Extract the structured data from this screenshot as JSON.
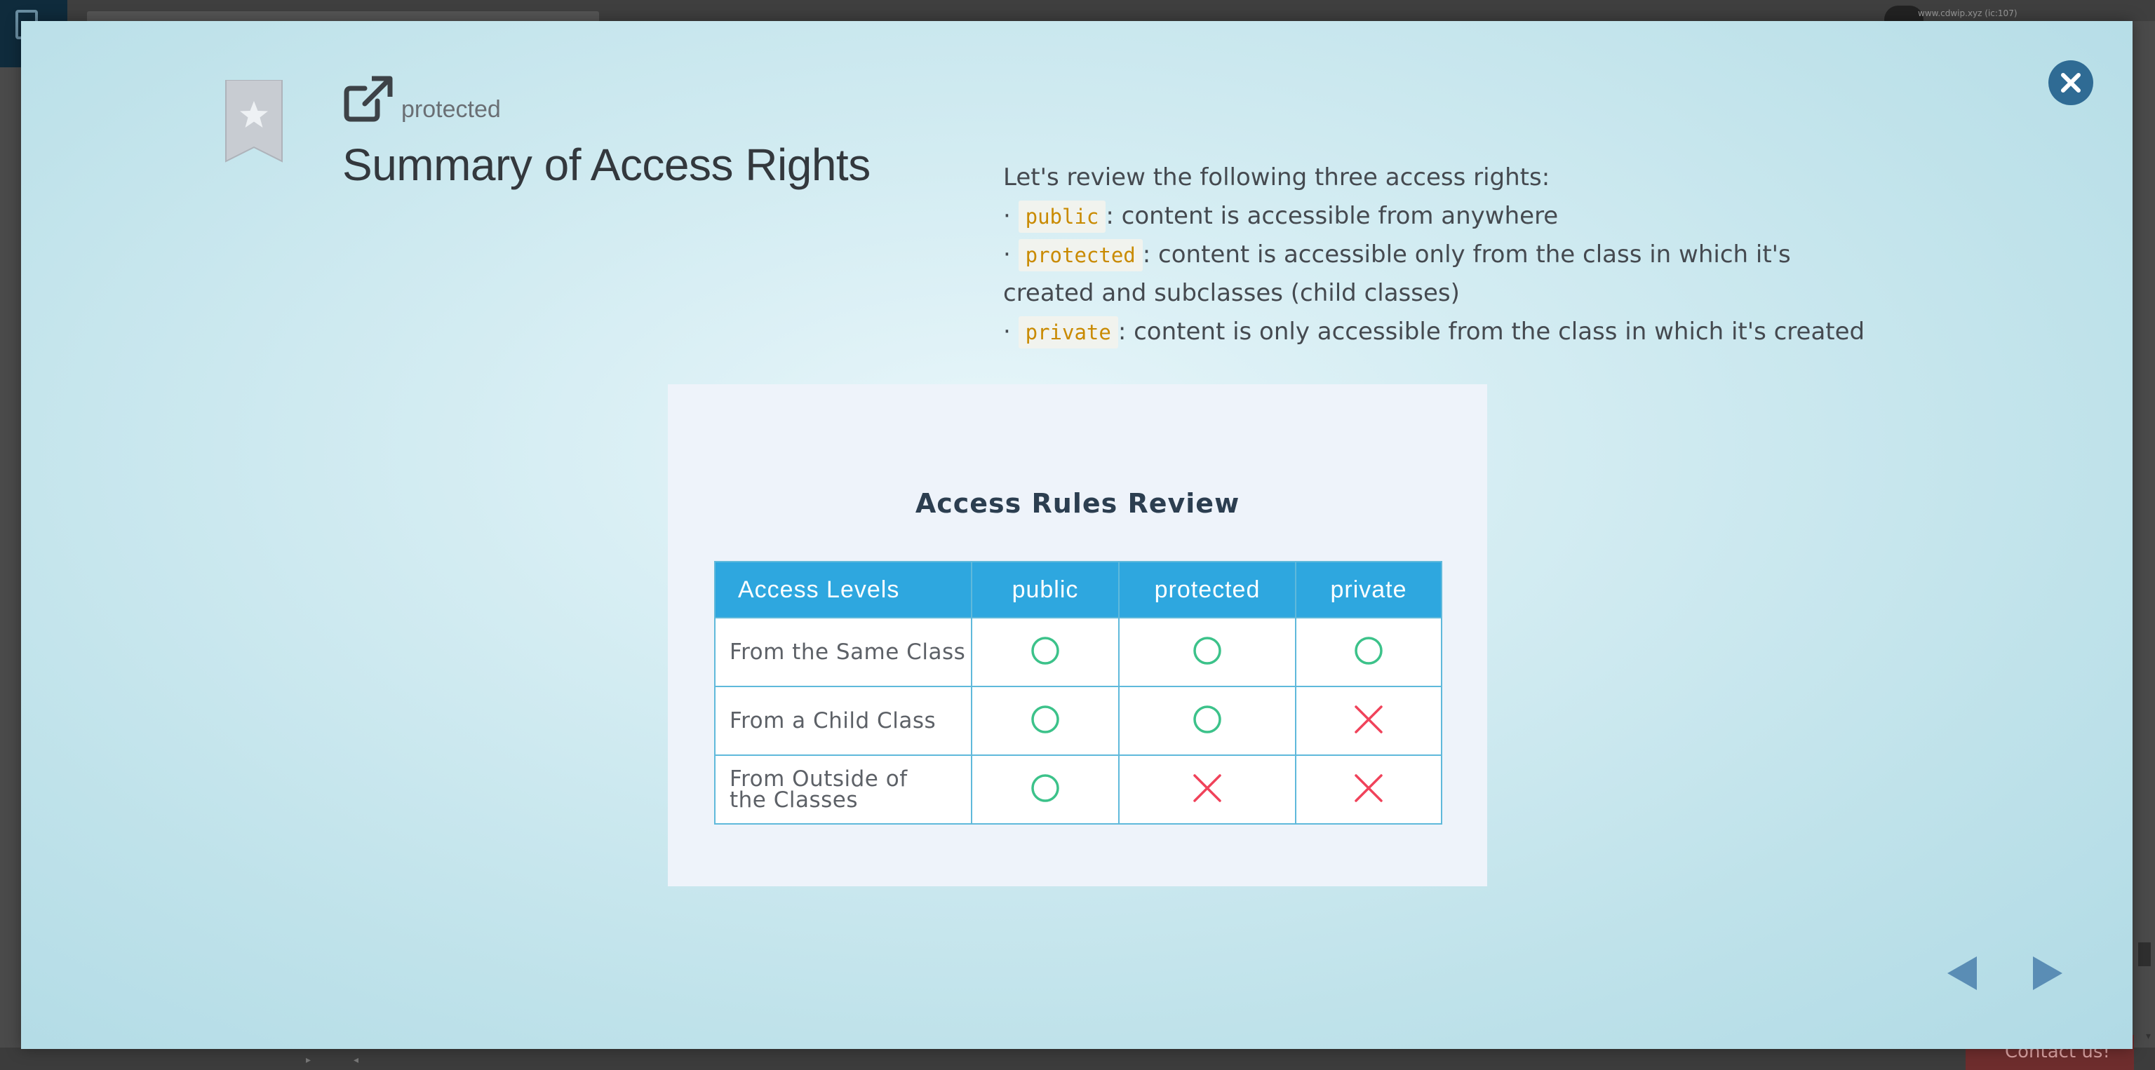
{
  "background": {
    "url_text": "www.cdwip.xyz (ic:107)",
    "contact_label": "Contact us!"
  },
  "slide": {
    "category": "protected",
    "title": "Summary of Access Rights",
    "intro": "Let's review the following three access rights:",
    "bullets": [
      {
        "bullet": "·",
        "keyword": "public",
        "text": ": content is accessible from anywhere"
      },
      {
        "bullet": "·",
        "keyword": "protected",
        "text": ": content is accessible only from the class in which it's",
        "continuation": "created and subclasses (child classes)"
      },
      {
        "bullet": "·",
        "keyword": "private",
        "text": ": content is only accessible from the class in which it's created"
      }
    ]
  },
  "figure": {
    "title": "Access Rules Review",
    "headers": [
      "Access Levels",
      "public",
      "protected",
      "private"
    ],
    "rows": [
      {
        "label": "From the Same Class",
        "values": [
          "allowed",
          "allowed",
          "allowed"
        ]
      },
      {
        "label": "From a Child Class",
        "values": [
          "allowed",
          "allowed",
          "denied"
        ]
      },
      {
        "label_line1": "From Outside of",
        "label_line2": "the Classes",
        "values": [
          "allowed",
          "denied",
          "denied"
        ]
      }
    ],
    "colors": {
      "allowed": "#3cc28a",
      "denied": "#f0425a",
      "header": "#2ea7df"
    }
  },
  "icons": {
    "bookmark": "bookmark-star-icon",
    "external": "external-link-icon",
    "close": "close-icon",
    "prev": "prev-arrow-icon",
    "next": "next-arrow-icon"
  },
  "colors": {
    "accent": "#2f6b94",
    "code_text": "#c98a00"
  }
}
